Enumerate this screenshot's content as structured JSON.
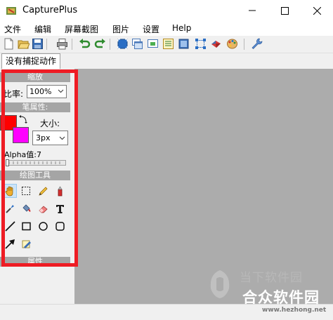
{
  "window": {
    "title": "CapturePlus",
    "controls": [
      "minimize",
      "maximize",
      "close"
    ]
  },
  "menu": {
    "items": [
      "文件",
      "编辑",
      "屏幕截图",
      "图片",
      "设置",
      "Help"
    ]
  },
  "toolbar": {
    "icons": [
      "new-icon",
      "open-icon",
      "save-icon",
      "print-icon",
      "undo-icon",
      "redo-icon",
      "capture-fullscreen-icon",
      "capture-window-icon",
      "capture-region-icon",
      "capture-scroll-icon",
      "capture-freehand-icon",
      "capture-object-icon",
      "capture-hotspot-icon",
      "color-palette-icon",
      "wrench-icon"
    ]
  },
  "tabs": {
    "active_label": "没有捕捉动作"
  },
  "left_panel": {
    "zoom_header": "缩放",
    "zoom_label": "比率:",
    "zoom_value": "100%",
    "pen_header": "笔属性:",
    "fg_color": "#ff0000",
    "bg_color": "#ff00ff",
    "size_label": "大小:",
    "size_value": "3px",
    "alpha_label": "Alpha值:7",
    "tools_header": "绘图工具",
    "tools": [
      "hand-icon",
      "rect-select-icon",
      "pencil-icon",
      "highlighter-icon",
      "eyedropper-icon",
      "paint-bucket-icon",
      "eraser-icon",
      "text-icon",
      "line-icon",
      "rectangle-icon",
      "ellipse-icon",
      "rounded-rect-icon",
      "arrow-icon",
      "blur-icon"
    ],
    "properties_header": "属性"
  },
  "highlight_color": "#ee1c24",
  "watermark": {
    "site": "当下软件园",
    "title": "合众软件园",
    "url": "www.hezhong.net"
  }
}
